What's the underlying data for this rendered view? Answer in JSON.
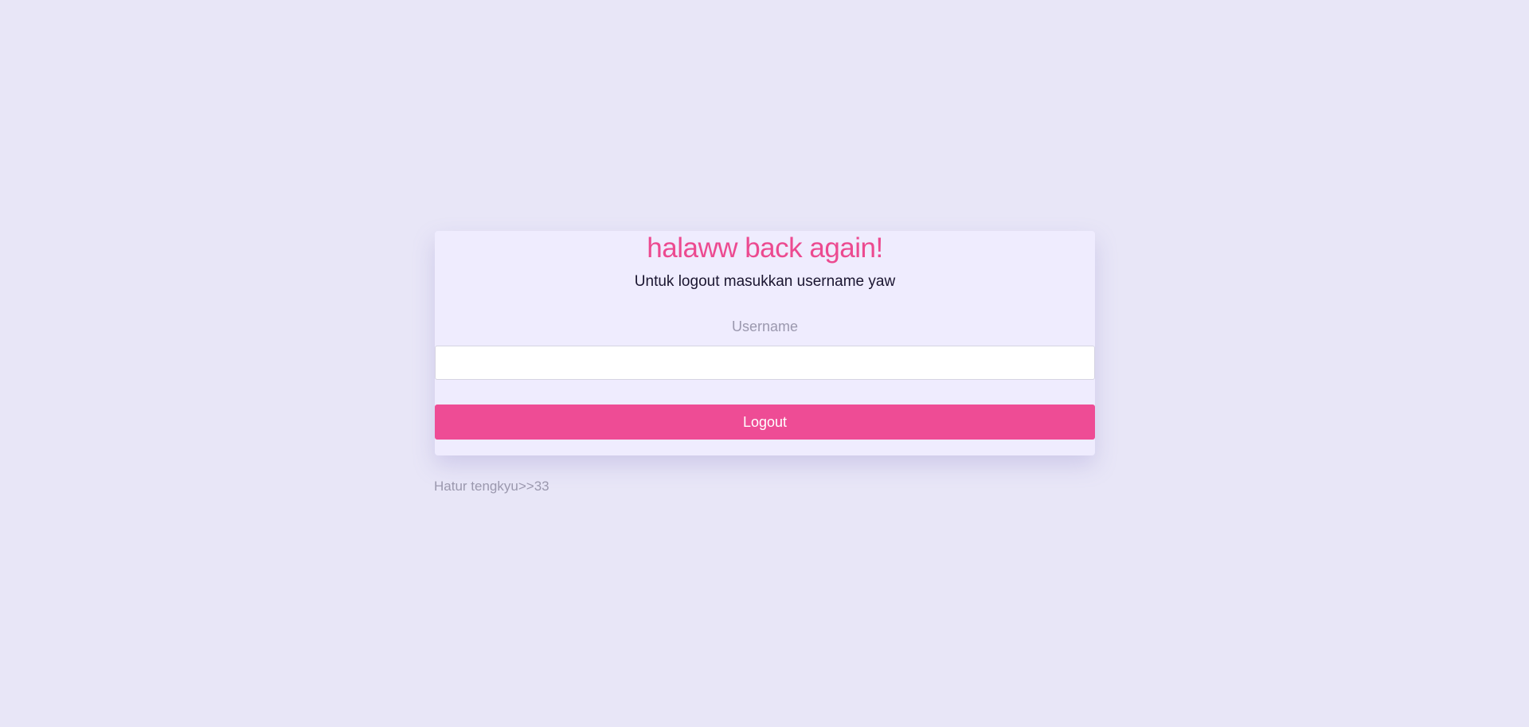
{
  "form": {
    "title": "halaww back again!",
    "subtitle": "Untuk logout masukkan username yaw",
    "username_label": "Username",
    "username_value": "",
    "logout_label": "Logout"
  },
  "footer": {
    "note": "Hatur tengkyu>>33"
  },
  "colors": {
    "background": "#e8e6f7",
    "card": "#efecfe",
    "accent": "#ee4c95"
  }
}
